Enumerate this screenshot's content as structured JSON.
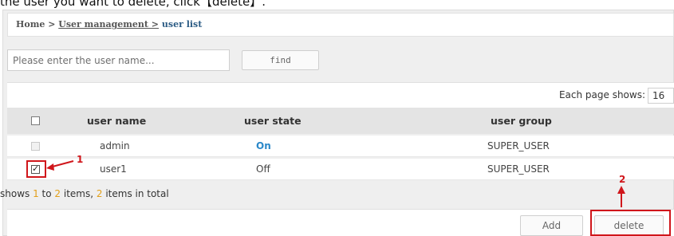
{
  "caption": "the user you want to delete, click【delete】.",
  "breadcrumb": {
    "home": "Home",
    "sep1": " > ",
    "section": "User management >",
    "sep2": " ",
    "current": "user list"
  },
  "search": {
    "placeholder": "Please enter the user name...",
    "value": ""
  },
  "find_label": "find",
  "per_page": {
    "label": "Each page shows:",
    "value": "16"
  },
  "table": {
    "headers": {
      "name": "user name",
      "state": "user state",
      "group": "user group"
    },
    "rows": [
      {
        "name": "admin",
        "state": "On",
        "group": "SUPER_USER",
        "checked": false,
        "disabled": true
      },
      {
        "name": "user1",
        "state": "Off",
        "group": "SUPER_USER",
        "checked": true,
        "disabled": false
      }
    ]
  },
  "summary": {
    "prefix": "shows ",
    "from": "1",
    "to_word": " to ",
    "to": "2",
    "mid": " items, ",
    "total": "2",
    "suffix": " items in total"
  },
  "buttons": {
    "add": "Add",
    "delete": "delete"
  },
  "annotations": {
    "step1": "1",
    "step2": "2",
    "color": "#d0161b"
  }
}
